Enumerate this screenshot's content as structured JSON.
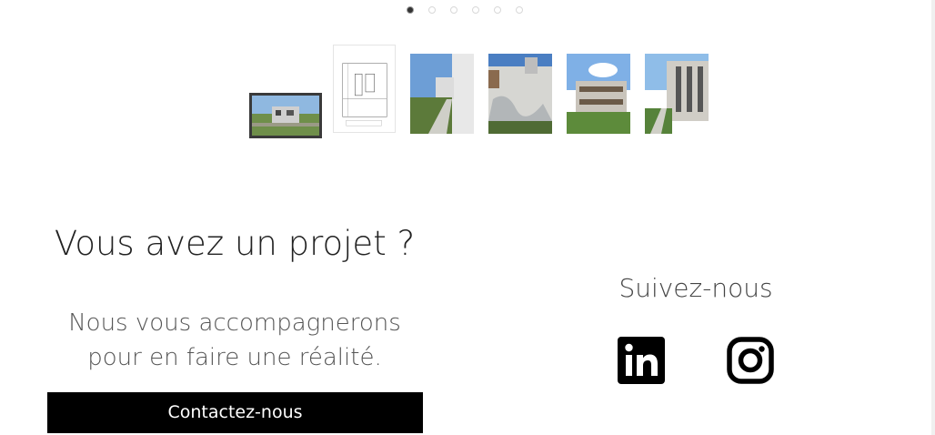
{
  "gallery": {
    "dots_count": 6,
    "active_dot": 0,
    "thumbnails": [
      {
        "name": "thumbnail-building-exterior",
        "active": true
      },
      {
        "name": "thumbnail-floor-plan",
        "active": false
      },
      {
        "name": "thumbnail-walkway",
        "active": false
      },
      {
        "name": "thumbnail-facade-shadows",
        "active": false
      },
      {
        "name": "thumbnail-garden-terraces",
        "active": false
      },
      {
        "name": "thumbnail-residence-row",
        "active": false
      }
    ]
  },
  "cta": {
    "title": "Vous avez un projet ?",
    "subtitle_line1": "Nous vous accompagnerons",
    "subtitle_line2": "pour en faire une réalité.",
    "button_label": "Contactez-nous"
  },
  "social": {
    "title": "Suivez-nous",
    "links": [
      {
        "icon": "linkedin-icon"
      },
      {
        "icon": "instagram-icon"
      }
    ]
  },
  "colors": {
    "button_bg": "#000000",
    "text_dark": "#222222",
    "text_muted": "#555555"
  }
}
